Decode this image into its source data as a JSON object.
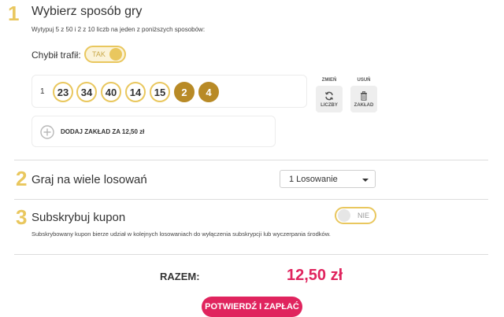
{
  "step1": {
    "number": "1",
    "title": "Wybierz sposób gry",
    "subtitle": "Wytypuj 5 z 50 i 2 z 10 liczb na jeden z poniższych sposobów:",
    "quickpick_label": "Chybił trafił:",
    "quickpick_toggle": "TAK",
    "bet": {
      "index": "1",
      "main_numbers": [
        "23",
        "34",
        "40",
        "14",
        "15"
      ],
      "extra_numbers": [
        "2",
        "4"
      ]
    },
    "change_label": "ZMIEŃ",
    "change_button": "LICZBY",
    "delete_label": "USUŃ",
    "delete_button": "ZAKŁAD",
    "add_bet": "DODAJ ZAKŁAD ZA 12,50 zł"
  },
  "step2": {
    "number": "2",
    "title": "Graj na wiele losowań",
    "select_value": "1 Losowanie"
  },
  "step3": {
    "number": "3",
    "title": "Subskrybuj kupon",
    "toggle": "NIE",
    "description": "Subskrybowany kupon bierze udział w kolejnych losowaniach do wyłączenia subskrypcji lub wyczerpania środków."
  },
  "summary": {
    "label": "RAZEM:",
    "total": "12,50 zł",
    "pay_button": "POTWIERDŹ I ZAPŁAĆ"
  },
  "colors": {
    "accent_gold": "#e9c75e",
    "extra_ball": "#b88a26",
    "price_pink": "#e0245e",
    "toggle_off": "#e6e6e6"
  }
}
